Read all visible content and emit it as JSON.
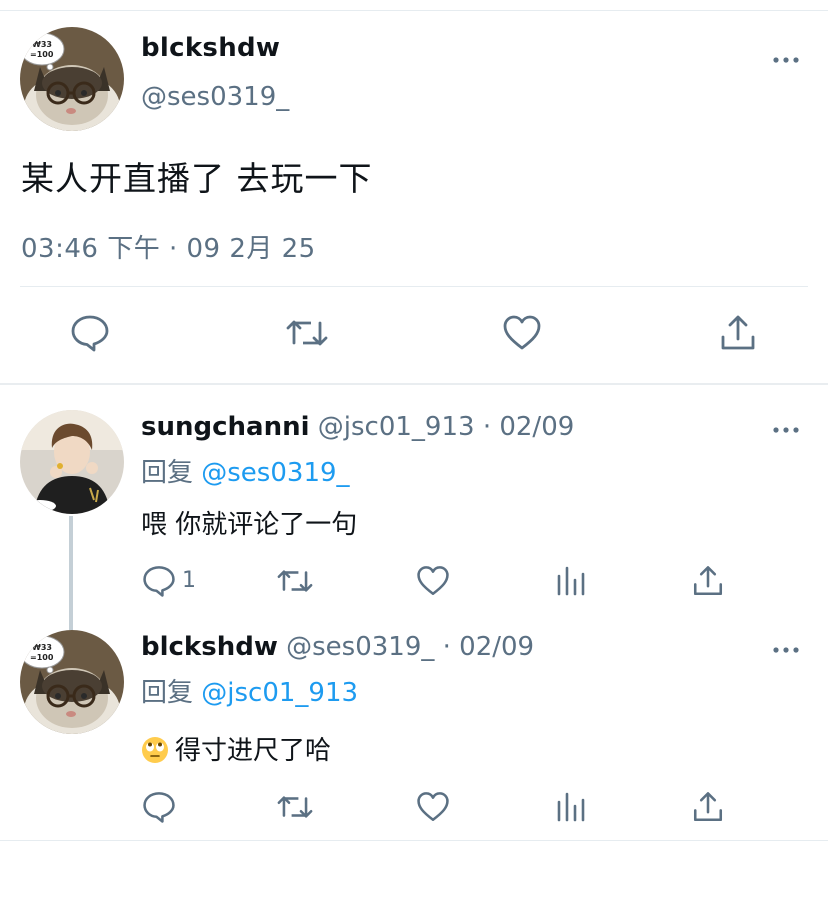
{
  "main_tweet": {
    "display_name": "blckshdw",
    "handle": "@ses0319_",
    "text": "某人开直播了 去玩一下",
    "timestamp": "03:46 下午 · 09 2月 25",
    "avatar_icon": "cat-with-glasses-avatar",
    "avatar_bubble_text": "₩33\n=100"
  },
  "replies": [
    {
      "display_name": "sungchanni",
      "meta": " @jsc01_913 · 02/09",
      "reply_to_prefix": "回复 ",
      "reply_to_mention": "@ses0319_",
      "text": "喂 你就评论了一句",
      "reply_count": "1",
      "avatar_icon": "person-photo-avatar"
    },
    {
      "display_name": "blckshdw",
      "meta": " @ses0319_ · 02/09",
      "reply_to_prefix": "回复 ",
      "reply_to_mention": "@jsc01_913",
      "emoji": "rolling-eyes-emoji",
      "text": "得寸进尺了哈",
      "reply_count": "",
      "avatar_icon": "cat-with-glasses-avatar"
    }
  ],
  "colors": {
    "text": "#0f1419",
    "secondary": "#5b7083",
    "mention": "#1d9bf0",
    "divider": "#e6ecf0"
  }
}
